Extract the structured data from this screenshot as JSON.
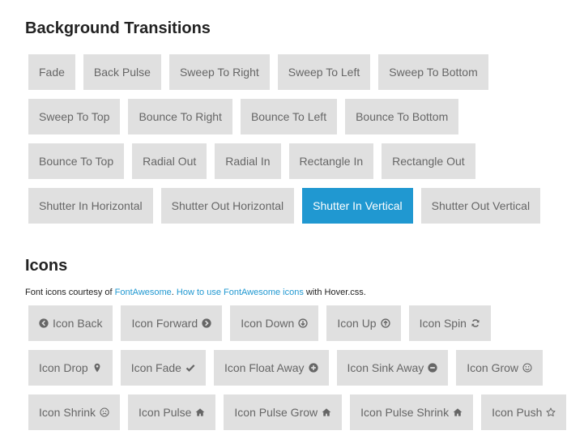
{
  "background_section": {
    "title": "Background Transitions",
    "rows": [
      [
        {
          "label": "Fade"
        },
        {
          "label": "Back Pulse"
        },
        {
          "label": "Sweep To Right"
        },
        {
          "label": "Sweep To Left"
        },
        {
          "label": "Sweep To Bottom"
        }
      ],
      [
        {
          "label": "Sweep To Top"
        },
        {
          "label": "Bounce To Right"
        },
        {
          "label": "Bounce To Left"
        },
        {
          "label": "Bounce To Bottom"
        }
      ],
      [
        {
          "label": "Bounce To Top"
        },
        {
          "label": "Radial Out"
        },
        {
          "label": "Radial In"
        },
        {
          "label": "Rectangle In"
        },
        {
          "label": "Rectangle Out"
        }
      ],
      [
        {
          "label": "Shutter In Horizontal"
        },
        {
          "label": "Shutter Out Horizontal"
        },
        {
          "label": "Shutter In Vertical",
          "active": true
        },
        {
          "label": "Shutter Out Vertical"
        }
      ]
    ]
  },
  "icons_section": {
    "title": "Icons",
    "credit": {
      "prefix": "Font icons courtesy of ",
      "link1": "FontAwesome",
      "sep": ". ",
      "link2": "How to use FontAwesome icons",
      "suffix": " with Hover.css."
    },
    "rows": [
      [
        {
          "label": "Icon Back",
          "icon": "chevron-circle-left-icon",
          "side": "left"
        },
        {
          "label": "Icon Forward",
          "icon": "chevron-circle-right-icon",
          "side": "right"
        },
        {
          "label": "Icon Down",
          "icon": "arrow-circle-down-icon",
          "side": "right"
        },
        {
          "label": "Icon Up",
          "icon": "arrow-circle-up-icon",
          "side": "right"
        },
        {
          "label": "Icon Spin",
          "icon": "refresh-icon",
          "side": "right"
        }
      ],
      [
        {
          "label": "Icon Drop",
          "icon": "map-marker-icon",
          "side": "right"
        },
        {
          "label": "Icon Fade",
          "icon": "check-icon",
          "side": "right"
        },
        {
          "label": "Icon Float Away",
          "icon": "plus-circle-icon",
          "side": "right"
        },
        {
          "label": "Icon Sink Away",
          "icon": "minus-circle-icon",
          "side": "right"
        },
        {
          "label": "Icon Grow",
          "icon": "smile-icon",
          "side": "right"
        }
      ],
      [
        {
          "label": "Icon Shrink",
          "icon": "frown-icon",
          "side": "right"
        },
        {
          "label": "Icon Pulse",
          "icon": "home-icon",
          "side": "right"
        },
        {
          "label": "Icon Pulse Grow",
          "icon": "home-icon",
          "side": "right"
        },
        {
          "label": "Icon Pulse Shrink",
          "icon": "home-icon",
          "side": "right"
        },
        {
          "label": "Icon Push",
          "icon": "star-outline-icon",
          "side": "right"
        }
      ]
    ]
  },
  "colors": {
    "button_bg": "#e0e0e0",
    "button_text": "#666666",
    "active_bg": "#2098d1",
    "active_text": "#ffffff",
    "link": "#2098d1"
  }
}
